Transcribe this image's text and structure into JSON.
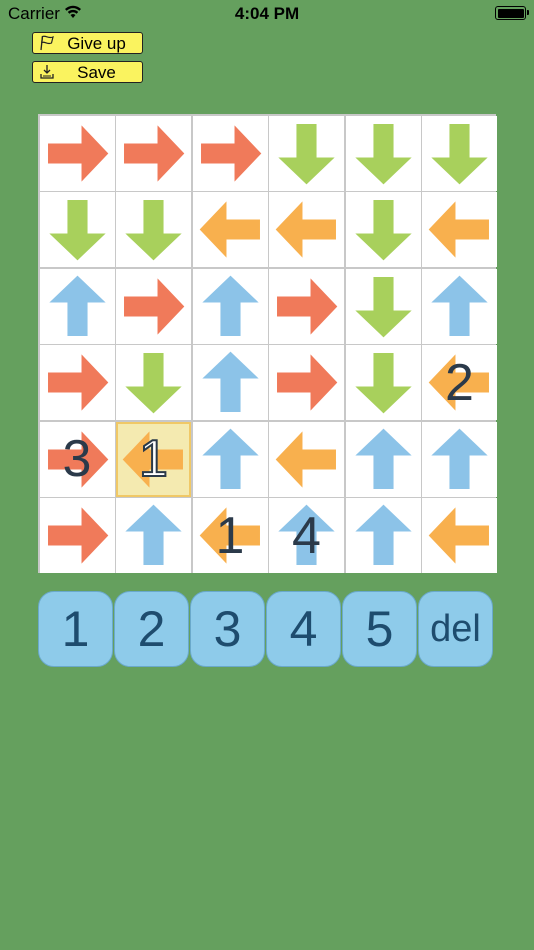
{
  "status_bar": {
    "carrier": "Carrier",
    "time": "4:04 PM"
  },
  "toolbar": {
    "give_up_label": "Give up",
    "save_label": "Save"
  },
  "colors": {
    "right": "#f07a5a",
    "down": "#a8d05c",
    "left": "#f8b04e",
    "up": "#8cc3e8"
  },
  "board": {
    "rows": 6,
    "cols": 6,
    "arrows": [
      [
        "right",
        "right",
        "right",
        "down",
        "down",
        "down"
      ],
      [
        "down",
        "down",
        "left",
        "left",
        "down",
        "left"
      ],
      [
        "up",
        "right",
        "up",
        "right",
        "down",
        "up"
      ],
      [
        "right",
        "down",
        "up",
        "right",
        "down",
        "left"
      ],
      [
        "right",
        "left",
        "up",
        "left",
        "up",
        "up"
      ],
      [
        "right",
        "up",
        "left",
        "up",
        "up",
        "left"
      ]
    ],
    "numbers": [
      [
        "",
        "",
        "",
        "",
        "",
        ""
      ],
      [
        "",
        "",
        "",
        "",
        "",
        ""
      ],
      [
        "",
        "",
        "",
        "",
        "",
        ""
      ],
      [
        "",
        "",
        "",
        "",
        "",
        "2"
      ],
      [
        "3",
        "1",
        "",
        "",
        "",
        ""
      ],
      [
        "",
        "",
        "1",
        "4",
        "",
        ""
      ]
    ],
    "selected": {
      "row": 4,
      "col": 1
    }
  },
  "number_pad": [
    "1",
    "2",
    "3",
    "4",
    "5",
    "del"
  ]
}
